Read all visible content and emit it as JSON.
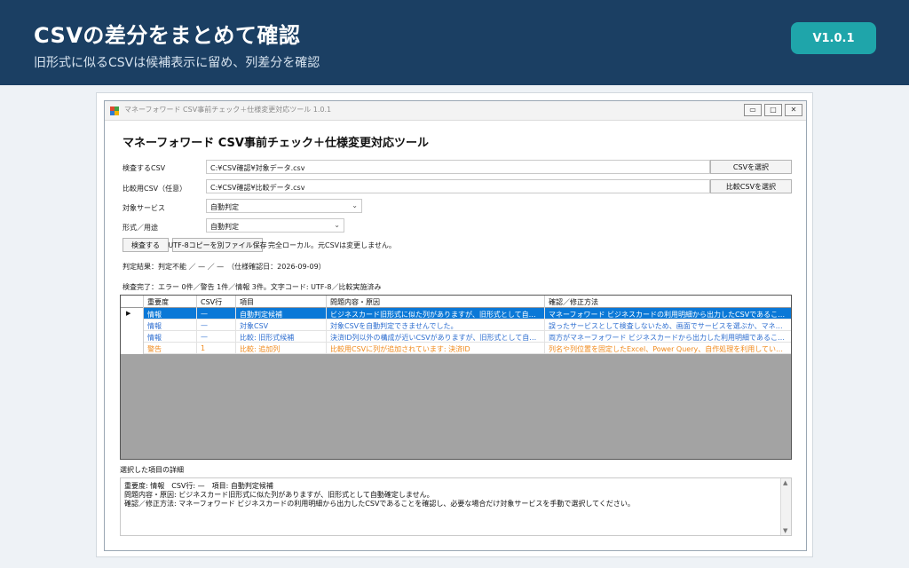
{
  "banner": {
    "title": "CSVの差分をまとめて確認",
    "subtitle": "旧形式に似るCSVは候補表示に留め、列差分を確認",
    "version": "V1.0.1"
  },
  "window": {
    "title": "マネーフォワード CSV事前チェック＋仕様変更対応ツール 1.0.1",
    "minimize": "▭",
    "maximize": "□",
    "close": "✕"
  },
  "form": {
    "heading": "マネーフォワード CSV事前チェック＋仕様変更対応ツール",
    "target_csv": {
      "label": "検査するCSV",
      "value": "C:¥CSV確認¥対象データ.csv",
      "button": "CSVを選択"
    },
    "compare_csv": {
      "label": "比較用CSV（任意）",
      "value": "C:¥CSV確認¥比較データ.csv",
      "button": "比較CSVを選択"
    },
    "service": {
      "label": "対象サービス",
      "selected": "自動判定"
    },
    "format": {
      "label": "形式／用途",
      "selected": "自動判定"
    },
    "check_button": "検査する",
    "save_button": "UTF-8コピーを別ファイル保存",
    "local_note": "完全ローカル。元CSVは変更しません。",
    "result_line": "判定結果：判定不能 ／ — ／ —　（仕様確認日：2026-09-09）",
    "summary_line": "検査完了：エラー 0件／警告 1件／情報 3件。文字コード: UTF-8／比較実施済み"
  },
  "grid": {
    "columns": [
      "重要度",
      "CSV行",
      "項目",
      "問題内容・原因",
      "確認／修正方法"
    ],
    "rows": [
      {
        "level": "情報",
        "line": "—",
        "item": "自動判定候補",
        "issue": "ビジネスカード旧形式に似た列がありますが、旧形式として自動確定しませ…",
        "fix": "マネーフォワード ビジネスカードの利用明細から出力したCSVであることを確認し、必要…",
        "kind": "info",
        "selected": true
      },
      {
        "level": "情報",
        "line": "—",
        "item": "対象CSV",
        "issue": "対象CSVを自動判定できませんでした。",
        "fix": "誤ったサービスとして検査しないため、画面でサービスを選ぶか、マネーフォワードから出…",
        "kind": "info",
        "selected": false
      },
      {
        "level": "情報",
        "line": "—",
        "item": "比較: 旧形式候補",
        "issue": "決済ID列以外の構成が近いCSVがありますが、旧形式として自動確定し…",
        "fix": "両方がマネーフォワード ビジネスカードから出力した利用明細であることを確認し、必…",
        "kind": "info",
        "selected": false
      },
      {
        "level": "警告",
        "line": "1",
        "item": "比較: 追加列",
        "issue": "比較用CSVに列が追加されています: 決済ID",
        "fix": "列名や列位置を固定したExcel、Power Query、自作処理を利用している場合は…",
        "kind": "warn",
        "selected": false
      }
    ]
  },
  "detail": {
    "label": "選択した項目の詳細",
    "lines": [
      "重要度: 情報　CSV行: —　項目: 自動判定候補",
      "問題内容・原因: ビジネスカード旧形式に似た列がありますが、旧形式として自動確定しません。",
      "確認／修正方法: マネーフォワード ビジネスカードの利用明細から出力したCSVであることを確認し、必要な場合だけ対象サービスを手動で選択してください。"
    ]
  }
}
